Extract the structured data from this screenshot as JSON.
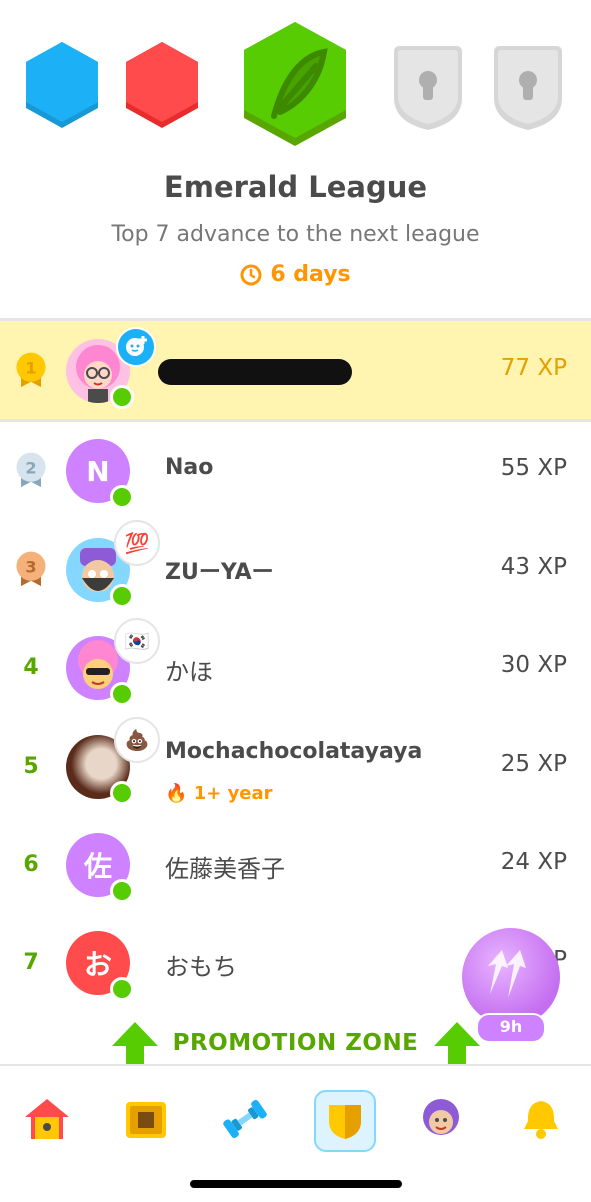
{
  "header": {
    "league_title": "Emerald League",
    "subtitle": "Top 7 advance to the next league",
    "time_left": "6 days",
    "badges": [
      {
        "name": "sapphire",
        "color": "#1cb0f6"
      },
      {
        "name": "ruby",
        "color": "#ff4b4b"
      },
      {
        "name": "emerald",
        "color": "#58cc02",
        "current": true
      },
      {
        "name": "locked",
        "color": "#e5e5e5"
      },
      {
        "name": "locked",
        "color": "#e5e5e5"
      }
    ]
  },
  "leaderboard": [
    {
      "rank": "1",
      "name": "",
      "xp": "77 XP",
      "avatar_letter": "",
      "flair_icon": "add-friend-icon"
    },
    {
      "rank": "2",
      "name": "Nao",
      "xp": "55 XP",
      "avatar_letter": "N"
    },
    {
      "rank": "3",
      "name": "ZUーYAー",
      "xp": "43 XP",
      "avatar_letter": "",
      "flair": "💯"
    },
    {
      "rank": "4",
      "name": "かほ",
      "xp": "30 XP",
      "avatar_letter": "",
      "flair": "🇰🇷"
    },
    {
      "rank": "5",
      "name": "Mochachocolatayaya",
      "xp": "25 XP",
      "avatar_letter": "",
      "flair": "💩",
      "streak": "1+ year"
    },
    {
      "rank": "6",
      "name": "佐藤美香子",
      "xp": "24 XP",
      "avatar_letter": "佐"
    },
    {
      "rank": "7",
      "name": "おもち",
      "xp": "P",
      "avatar_letter": "お"
    }
  ],
  "promotion_zone": "PROMOTION ZONE",
  "chest_timer": "9h",
  "tabs": [
    {
      "name": "home",
      "active": false
    },
    {
      "name": "characters",
      "active": false
    },
    {
      "name": "practice",
      "active": false
    },
    {
      "name": "leagues",
      "active": true
    },
    {
      "name": "profile",
      "active": false
    },
    {
      "name": "notifications",
      "active": false
    }
  ],
  "colors": {
    "highlight_row": "#fff4b0",
    "online": "#58cc02",
    "promo": "#58a700",
    "accent": "#ff9600"
  }
}
